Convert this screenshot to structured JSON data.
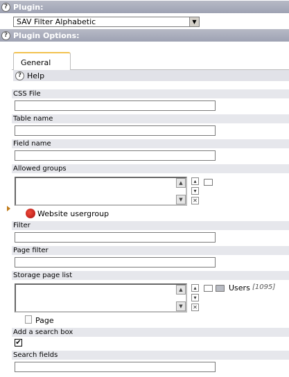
{
  "plugin_header": {
    "label": "Plugin:"
  },
  "plugin_select": {
    "value": "SAV Filter Alphabetic"
  },
  "options_header": {
    "label": "Plugin Options:"
  },
  "tabs": [
    {
      "label": "General"
    }
  ],
  "help": {
    "label": "Help"
  },
  "fields": {
    "css_file": {
      "label": "CSS File",
      "value": ""
    },
    "table_name": {
      "label": "Table name",
      "value": ""
    },
    "field_name": {
      "label": "Field name",
      "value": ""
    },
    "allowed_groups": {
      "label": "Allowed groups",
      "item": "Website usergroup"
    },
    "filter": {
      "label": "Filter",
      "value": ""
    },
    "page_filter": {
      "label": "Page filter",
      "value": ""
    },
    "storage_page_list": {
      "label": "Storage page list",
      "folder_item": "Users",
      "folder_id": "[1095]",
      "item": "Page"
    },
    "add_search_box": {
      "label": "Add a search box",
      "checked": "✔"
    },
    "search_fields": {
      "label": "Search fields",
      "value": ""
    }
  },
  "icons": {
    "help": "question-icon",
    "scroll_up": "arrow-up-icon",
    "scroll_down": "arrow-down-icon",
    "move_up": "chevron-up-icon",
    "move_down": "chevron-down-icon",
    "remove": "close-icon",
    "folder": "folder-icon",
    "page": "page-icon",
    "usergroup": "usergroup-icon",
    "marker": "triangle-right-icon"
  },
  "colors": {
    "header_bg": "#a4a8b8",
    "label_bg": "#e6e7ec",
    "tab_accent": "#f2c14e"
  }
}
